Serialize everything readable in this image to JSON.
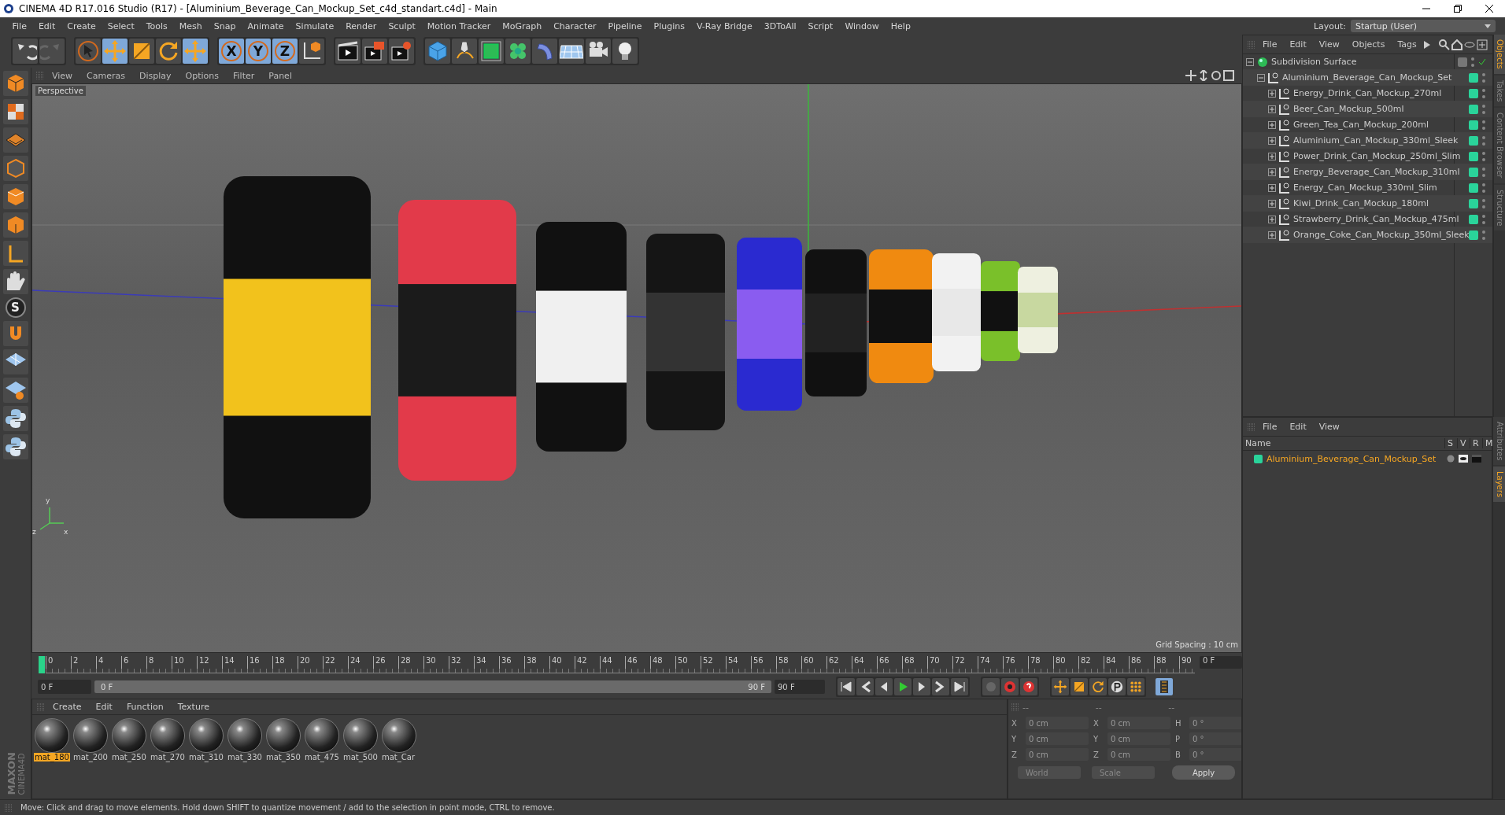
{
  "window": {
    "title": "CINEMA 4D R17.016 Studio (R17) - [Aluminium_Beverage_Can_Mockup_Set_c4d_standart.c4d] - Main"
  },
  "menu": [
    "File",
    "Edit",
    "Create",
    "Select",
    "Tools",
    "Mesh",
    "Snap",
    "Animate",
    "Simulate",
    "Render",
    "Sculpt",
    "Motion Tracker",
    "MoGraph",
    "Character",
    "Pipeline",
    "Plugins",
    "V-Ray Bridge",
    "3DToAll",
    "Script",
    "Window",
    "Help"
  ],
  "layout": {
    "label": "Layout:",
    "value": "Startup (User)"
  },
  "toolbar": {
    "axis_buttons": [
      {
        "label": "X",
        "selected": true
      },
      {
        "label": "Y",
        "selected": true
      },
      {
        "label": "Z",
        "selected": true
      }
    ]
  },
  "side_tools": {
    "snap_label": "S"
  },
  "viewport": {
    "menu": [
      "View",
      "Cameras",
      "Display",
      "Options",
      "Filter",
      "Panel"
    ],
    "camera": "Perspective",
    "grid_spacing": "Grid Spacing : 10 cm",
    "axis_labels": [
      "y",
      "z",
      "x"
    ]
  },
  "objects": {
    "menu": [
      "File",
      "Edit",
      "View",
      "Objects",
      "Tags"
    ],
    "tree": [
      {
        "name": "Subdivision Surface",
        "kind": "generator",
        "expanded": true,
        "children": [
          {
            "name": "Aluminium_Beverage_Can_Mockup_Set",
            "kind": "null",
            "expanded": true,
            "children": [
              {
                "name": "Energy_Drink_Can_Mockup_270ml",
                "kind": "null",
                "expanded": false
              },
              {
                "name": "Beer_Can_Mockup_500ml",
                "kind": "null",
                "expanded": false
              },
              {
                "name": "Green_Tea_Can_Mockup_200ml",
                "kind": "null",
                "expanded": false
              },
              {
                "name": "Aluminium_Can_Mockup_330ml_Sleek",
                "kind": "null",
                "expanded": false
              },
              {
                "name": "Power_Drink_Can_Mockup_250ml_Slim",
                "kind": "null",
                "expanded": false
              },
              {
                "name": "Energy_Beverage_Can_Mockup_310ml",
                "kind": "null",
                "expanded": false
              },
              {
                "name": "Energy_Can_Mockup_330ml_Slim",
                "kind": "null",
                "expanded": false
              },
              {
                "name": "Kiwi_Drink_Can_Mockup_180ml",
                "kind": "null",
                "expanded": false
              },
              {
                "name": "Strawberry_Drink_Can_Mockup_475ml",
                "kind": "null",
                "expanded": false
              },
              {
                "name": "Orange_Coke_Can_Mockup_350ml_Sleek",
                "kind": "null",
                "expanded": false
              }
            ]
          }
        ]
      }
    ],
    "side_tabs": [
      {
        "label": "Objects",
        "selected": true
      },
      {
        "label": "Takes",
        "selected": false
      },
      {
        "label": "Content Browser",
        "selected": false
      },
      {
        "label": "Structure",
        "selected": false
      }
    ]
  },
  "layers": {
    "menu": [
      "File",
      "Edit",
      "View"
    ],
    "columns": [
      "Name",
      "S",
      "V",
      "R",
      "M"
    ],
    "rows": [
      {
        "name": "Aluminium_Beverage_Can_Mockup_Set",
        "color": "#2ad39a"
      }
    ],
    "side_tabs": [
      {
        "label": "Attributes",
        "selected": false
      },
      {
        "label": "Layers",
        "selected": true
      }
    ]
  },
  "timeline": {
    "ticks": [
      "0",
      "2",
      "4",
      "6",
      "8",
      "10",
      "12",
      "14",
      "16",
      "18",
      "20",
      "22",
      "24",
      "26",
      "28",
      "30",
      "32",
      "34",
      "36",
      "38",
      "40",
      "42",
      "44",
      "46",
      "48",
      "50",
      "52",
      "54",
      "56",
      "58",
      "60",
      "62",
      "64",
      "66",
      "68",
      "70",
      "72",
      "74",
      "76",
      "78",
      "80",
      "82",
      "84",
      "86",
      "88",
      "90"
    ],
    "current_frame": "0 F",
    "start_field": "0 F",
    "range": {
      "start": "0 F",
      "end": "90 F",
      "level": 1
    },
    "end_field": "90 F"
  },
  "materials": {
    "menu": [
      "Create",
      "Edit",
      "Function",
      "Texture"
    ],
    "items": [
      {
        "name": "mat_180",
        "selected": true
      },
      {
        "name": "mat_200",
        "selected": false
      },
      {
        "name": "mat_250",
        "selected": false
      },
      {
        "name": "mat_270",
        "selected": false
      },
      {
        "name": "mat_310",
        "selected": false
      },
      {
        "name": "mat_330",
        "selected": false
      },
      {
        "name": "mat_350",
        "selected": false
      },
      {
        "name": "mat_475",
        "selected": false
      },
      {
        "name": "mat_500",
        "selected": false
      },
      {
        "name": "mat_Car",
        "selected": false
      }
    ],
    "logo": [
      "MAXON",
      "CINEMA4D"
    ]
  },
  "coordinates": {
    "headers": [
      "--",
      "--",
      "--"
    ],
    "rows": [
      [
        {
          "axis": "X",
          "value": "0 cm"
        },
        {
          "axis": "X",
          "value": "0 cm"
        },
        {
          "axis": "H",
          "value": "0 °"
        }
      ],
      [
        {
          "axis": "Y",
          "value": "0 cm"
        },
        {
          "axis": "Y",
          "value": "0 cm"
        },
        {
          "axis": "P",
          "value": "0 °"
        }
      ],
      [
        {
          "axis": "Z",
          "value": "0 cm"
        },
        {
          "axis": "Z",
          "value": "0 cm"
        },
        {
          "axis": "B",
          "value": "0 °"
        }
      ]
    ],
    "space": "World",
    "mode": "Scale",
    "apply": "Apply"
  },
  "status": "Move: Click and drag to move elements. Hold down SHIFT to quantize movement / add to the selection in point mode, CTRL to remove."
}
